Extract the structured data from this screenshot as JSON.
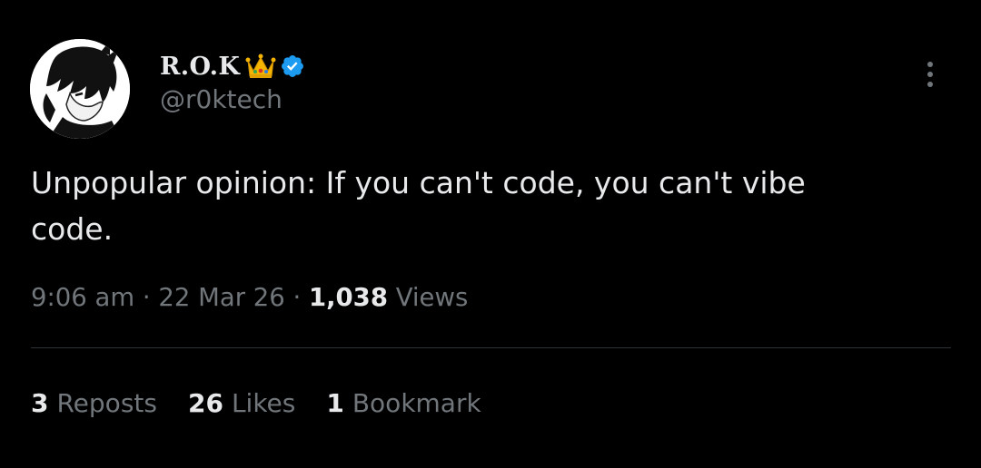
{
  "author": {
    "display_name": "R.O.K",
    "handle": "@r0ktech",
    "badges": [
      "crown-icon",
      "verified-icon"
    ],
    "avatar": "avatar"
  },
  "tweet": {
    "text": "Unpopular opinion: If you can't code, you can't vibe\ncode."
  },
  "meta": {
    "time": "9:06 am",
    "separator": " · ",
    "date": "22 Mar 26",
    "views_count": "1,038",
    "views_label": " Views"
  },
  "stats": {
    "reposts_count": "3",
    "reposts_label": "Reposts",
    "likes_count": "26",
    "likes_label": "Likes",
    "bookmarks_count": "1",
    "bookmarks_label": "Bookmark"
  },
  "colors": {
    "background": "#000000",
    "primary_text": "#e7e9ea",
    "secondary_text": "#71767b",
    "verified_blue": "#1d9bf0",
    "divider": "#2f3336"
  }
}
